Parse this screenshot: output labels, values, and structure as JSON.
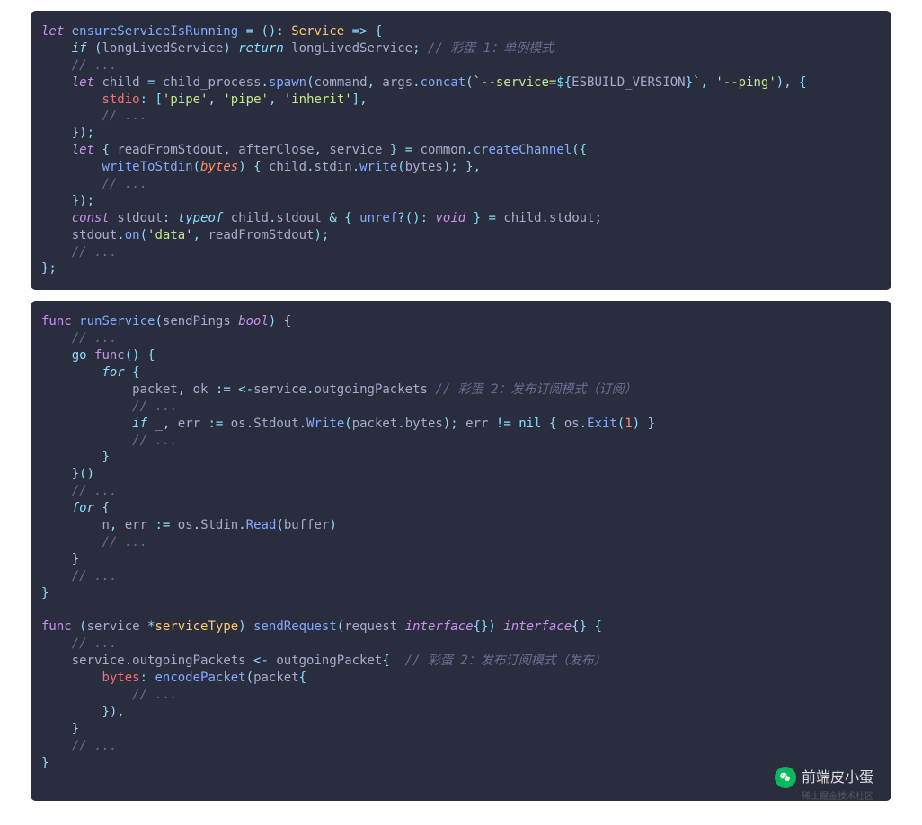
{
  "block1": {
    "lines": [
      {
        "html": "<span class='kw-let'>let</span> <span class='fn'>ensureServiceIsRunning</span> <span class='op'>=</span> <span class='punc'>()</span><span class='op'>:</span> <span class='type'>Service</span> <span class='op'>=&gt;</span> <span class='punc'>{</span>"
      },
      {
        "html": "    <span class='kw-if'>if</span> <span class='punc'>(</span><span class='id'>longLivedService</span><span class='punc'>)</span> <span class='kw-ret'>return</span> <span class='id'>longLivedService</span><span class='punc'>;</span> <span class='comment'>// 彩蛋 1：单例模式</span>"
      },
      {
        "html": "    <span class='comment'>// ...</span>"
      },
      {
        "html": "    <span class='kw-let'>let</span> <span class='id'>child</span> <span class='op'>=</span> <span class='id'>child_process</span><span class='punc'>.</span><span class='fn'>spawn</span><span class='punc'>(</span><span class='id'>command</span><span class='punc'>,</span> <span class='id'>args</span><span class='punc'>.</span><span class='fn'>concat</span><span class='punc'>(</span><span class='tpl'>`--service=</span><span class='tplvar'>${</span><span class='id'>ESBUILD_VERSION</span><span class='tplvar'>}</span><span class='tpl'>`</span><span class='punc'>,</span> <span class='str'>'--ping'</span><span class='punc'>),</span> <span class='punc'>{</span>"
      },
      {
        "html": "        <span class='prop'>stdio</span><span class='op'>:</span> <span class='punc'>[</span><span class='str'>'pipe'</span><span class='punc'>,</span> <span class='str'>'pipe'</span><span class='punc'>,</span> <span class='str'>'inherit'</span><span class='punc'>],</span>"
      },
      {
        "html": "        <span class='comment'>// ...</span>"
      },
      {
        "html": "    <span class='punc'>});</span>"
      },
      {
        "html": "    <span class='kw-let'>let</span> <span class='punc'>{</span> <span class='id'>readFromStdout</span><span class='punc'>,</span> <span class='id'>afterClose</span><span class='punc'>,</span> <span class='id'>service</span> <span class='punc'>}</span> <span class='op'>=</span> <span class='id'>common</span><span class='punc'>.</span><span class='fn'>createChannel</span><span class='punc'>({</span>"
      },
      {
        "html": "        <span class='fn'>writeToStdin</span><span class='punc'>(</span><span class='param'>bytes</span><span class='punc'>)</span> <span class='punc'>{</span> <span class='id'>child</span><span class='punc'>.</span><span class='id'>stdin</span><span class='punc'>.</span><span class='fn'>write</span><span class='punc'>(</span><span class='id'>bytes</span><span class='punc'>);</span> <span class='punc'>},</span>"
      },
      {
        "html": "        <span class='comment'>// ...</span>"
      },
      {
        "html": "    <span class='punc'>});</span>"
      },
      {
        "html": "    <span class='kw-const'>const</span> <span class='id'>stdout</span><span class='op'>:</span> <span class='kw-typeof'>typeof</span> <span class='id'>child</span><span class='punc'>.</span><span class='id'>stdout</span> <span class='op'>&amp;</span> <span class='punc'>{</span> <span class='fn'>unref</span><span class='op'>?</span><span class='punc'>()</span><span class='op'>:</span> <span class='kw-void'>void</span> <span class='punc'>}</span> <span class='op'>=</span> <span class='id'>child</span><span class='punc'>.</span><span class='id'>stdout</span><span class='punc'>;</span>"
      },
      {
        "html": "    <span class='id'>stdout</span><span class='punc'>.</span><span class='fn'>on</span><span class='punc'>(</span><span class='str'>'data'</span><span class='punc'>,</span> <span class='id'>readFromStdout</span><span class='punc'>);</span>"
      },
      {
        "html": "    <span class='comment'>// ...</span>"
      },
      {
        "html": "<span class='punc'>};</span>"
      }
    ]
  },
  "block2": {
    "lines": [
      {
        "html": "<span class='kw-func'>func</span> <span class='fn'>runService</span><span class='punc'>(</span><span class='id'>sendPings</span> <span class='kw-type'>bool</span><span class='punc'>)</span> <span class='punc'>{</span>"
      },
      {
        "html": "    <span class='comment'>// ...</span>"
      },
      {
        "html": "    <span class='kw-go'>go</span> <span class='kw-func'>func</span><span class='punc'>()</span> <span class='punc'>{</span>"
      },
      {
        "html": "        <span class='kw-for'>for</span> <span class='punc'>{</span>"
      },
      {
        "html": "            <span class='id'>packet</span><span class='punc'>,</span> <span class='id'>ok</span> <span class='op'>:=</span> <span class='op'>&lt;-</span><span class='id'>service</span><span class='punc'>.</span><span class='id'>outgoingPackets</span> <span class='comment'>// 彩蛋 2：发布订阅模式（订阅）</span>"
      },
      {
        "html": "            <span class='comment'>// ...</span>"
      },
      {
        "html": "            <span class='kw-if'>if</span> <span class='id'>_</span><span class='punc'>,</span> <span class='id'>err</span> <span class='op'>:=</span> <span class='id'>os</span><span class='punc'>.</span><span class='id'>Stdout</span><span class='punc'>.</span><span class='fn'>Write</span><span class='punc'>(</span><span class='id'>packet</span><span class='punc'>.</span><span class='id'>bytes</span><span class='punc'>);</span> <span class='id'>err</span> <span class='op'>!=</span> <span class='kw-nil'>nil</span> <span class='punc'>{</span> <span class='id'>os</span><span class='punc'>.</span><span class='fn'>Exit</span><span class='punc'>(</span><span class='num'>1</span><span class='punc'>)</span> <span class='punc'>}</span>"
      },
      {
        "html": "            <span class='comment'>// ...</span>"
      },
      {
        "html": "        <span class='punc'>}</span>"
      },
      {
        "html": "    <span class='punc'>}()</span>"
      },
      {
        "html": "    <span class='comment'>// ...</span>"
      },
      {
        "html": "    <span class='kw-for'>for</span> <span class='punc'>{</span>"
      },
      {
        "html": "        <span class='id'>n</span><span class='punc'>,</span> <span class='id'>err</span> <span class='op'>:=</span> <span class='id'>os</span><span class='punc'>.</span><span class='id'>Stdin</span><span class='punc'>.</span><span class='fn'>Read</span><span class='punc'>(</span><span class='id'>buffer</span><span class='punc'>)</span>"
      },
      {
        "html": "        <span class='comment'>// ...</span>"
      },
      {
        "html": "    <span class='punc'>}</span>"
      },
      {
        "html": "    <span class='comment'>// ...</span>"
      },
      {
        "html": "<span class='punc'>}</span>"
      },
      {
        "html": ""
      },
      {
        "html": "<span class='kw-func'>func</span> <span class='punc'>(</span><span class='id'>service</span> <span class='op'>*</span><span class='type'>serviceType</span><span class='punc'>)</span> <span class='fn'>sendRequest</span><span class='punc'>(</span><span class='id'>request</span> <span class='kw-type'>interface</span><span class='punc'>{})</span> <span class='kw-type'>interface</span><span class='punc'>{}</span> <span class='punc'>{</span>"
      },
      {
        "html": "    <span class='comment'>// ...</span>"
      },
      {
        "html": "    <span class='id'>service</span><span class='punc'>.</span><span class='id'>outgoingPackets</span> <span class='op'>&lt;-</span> <span class='id'>outgoingPacket</span><span class='punc'>{</span>  <span class='comment'>// 彩蛋 2：发布订阅模式（发布）</span>"
      },
      {
        "html": "        <span class='prop'>bytes</span><span class='op'>:</span> <span class='fn'>encodePacket</span><span class='punc'>(</span><span class='id'>packet</span><span class='punc'>{</span>"
      },
      {
        "html": "            <span class='comment'>// ...</span>"
      },
      {
        "html": "        <span class='punc'>}),</span>"
      },
      {
        "html": "    <span class='punc'>}</span>"
      },
      {
        "html": "    <span class='comment'>// ...</span>"
      },
      {
        "html": "<span class='punc'>}</span>"
      }
    ]
  },
  "watermark": {
    "text": "前端皮小蛋",
    "subtext": "稀土掘金技术社区"
  }
}
